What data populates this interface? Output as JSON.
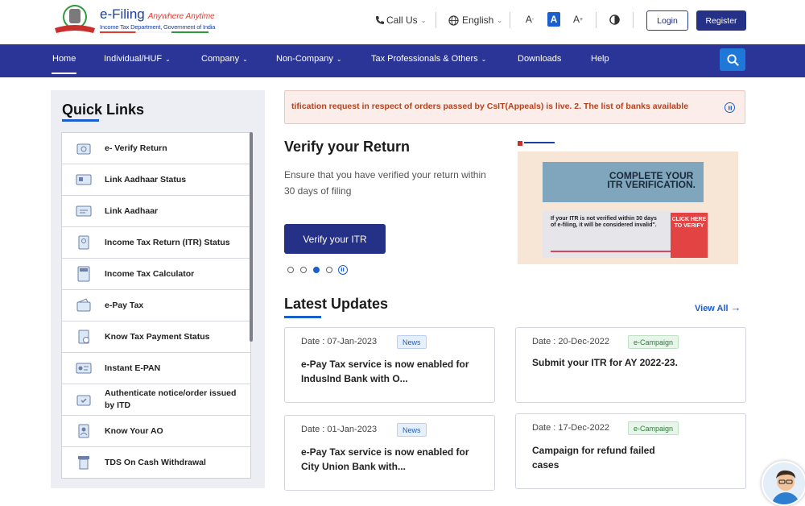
{
  "header": {
    "brand": "e-Filing",
    "tagline": "Anywhere Anytime",
    "subtitle": "Income Tax Department, Government of India",
    "call_us": "Call Us",
    "language": "English",
    "font_decrease": "A",
    "font_normal": "A",
    "font_increase": "A",
    "login": "Login",
    "register": "Register"
  },
  "nav": {
    "items": [
      "Home",
      "Individual/HUF",
      "Company",
      "Non-Company",
      "Tax Professionals & Others",
      "Downloads",
      "Help"
    ],
    "active": "Home"
  },
  "quick_links": {
    "title": "Quick Links",
    "items": [
      "e- Verify Return",
      "Link Aadhaar Status",
      "Link Aadhaar",
      "Income Tax Return (ITR) Status",
      "Income Tax Calculator",
      "e-Pay Tax",
      "Know Tax Payment Status",
      "Instant E-PAN",
      "Authenticate notice/order issued by ITD",
      "Know Your AO",
      "TDS On Cash Withdrawal"
    ]
  },
  "marquee": {
    "text": "tification request in respect of orders passed by CsIT(Appeals) is live. 2. The list of banks available"
  },
  "hero": {
    "title": "Verify your Return",
    "description": "Ensure that you have verified your return within 30 days of filing",
    "button": "Verify your ITR",
    "slide_count": 4,
    "active_slide": 3
  },
  "banner": {
    "headline_line1": "COMPLETE YOUR",
    "headline_line2": "ITR VERIFICATION.",
    "note": "If your ITR is not verified within 30 days of e-filing, it will be considered invalid\".",
    "cta": "CLICK HERE TO VERIFY"
  },
  "latest_updates": {
    "title": "Latest Updates",
    "view_all": "View All",
    "cards": [
      {
        "date": "Date : 07-Jan-2023",
        "tag": "News",
        "headline": "e-Pay Tax service is now enabled for IndusInd Bank with O..."
      },
      {
        "date": "Date : 20-Dec-2022",
        "tag": "e-Campaign",
        "headline": "Submit your ITR for AY 2022-23."
      },
      {
        "date": "Date : 01-Jan-2023",
        "tag": "News",
        "headline": "e-Pay Tax service is now enabled for City Union Bank with..."
      },
      {
        "date": "Date : 17-Dec-2022",
        "tag": "e-Campaign",
        "headline": "Campaign for refund failed cases"
      }
    ]
  },
  "colors": {
    "nav_bg": "#2b3598",
    "primary_button": "#253087",
    "accent_blue": "#1b5fcc",
    "marquee_text": "#b3431f"
  }
}
